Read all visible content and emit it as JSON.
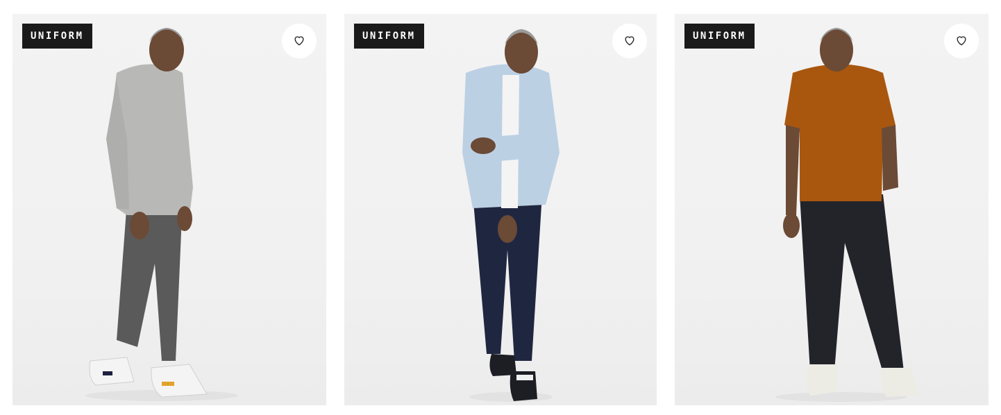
{
  "products": [
    {
      "badge": "UNIFORM",
      "favorite_icon": "heart-outline-icon",
      "image": "model-grey-hoodie-grey-pants-sneakers",
      "colors": {
        "top": "#b8b8b6",
        "pants": "#5a5a5a",
        "shoes": "#f4f4f4"
      }
    },
    {
      "badge": "UNIFORM",
      "favorite_icon": "heart-outline-icon",
      "image": "model-light-blue-oxford-navy-pants-sneakers",
      "colors": {
        "top": "#bcd0e4",
        "pants": "#1f2740",
        "shoes": "#1d1d24"
      }
    },
    {
      "badge": "UNIFORM",
      "favorite_icon": "heart-outline-icon",
      "image": "model-rust-tee-black-pants-white-sneakers",
      "colors": {
        "top": "#a9570f",
        "pants": "#22242a",
        "shoes": "#ecebe4"
      }
    }
  ],
  "theme": {
    "badge_bg": "#1a1a1a",
    "badge_text": "#ffffff",
    "card_bg": "#f1f1f1",
    "skin": "#6b4a36"
  }
}
